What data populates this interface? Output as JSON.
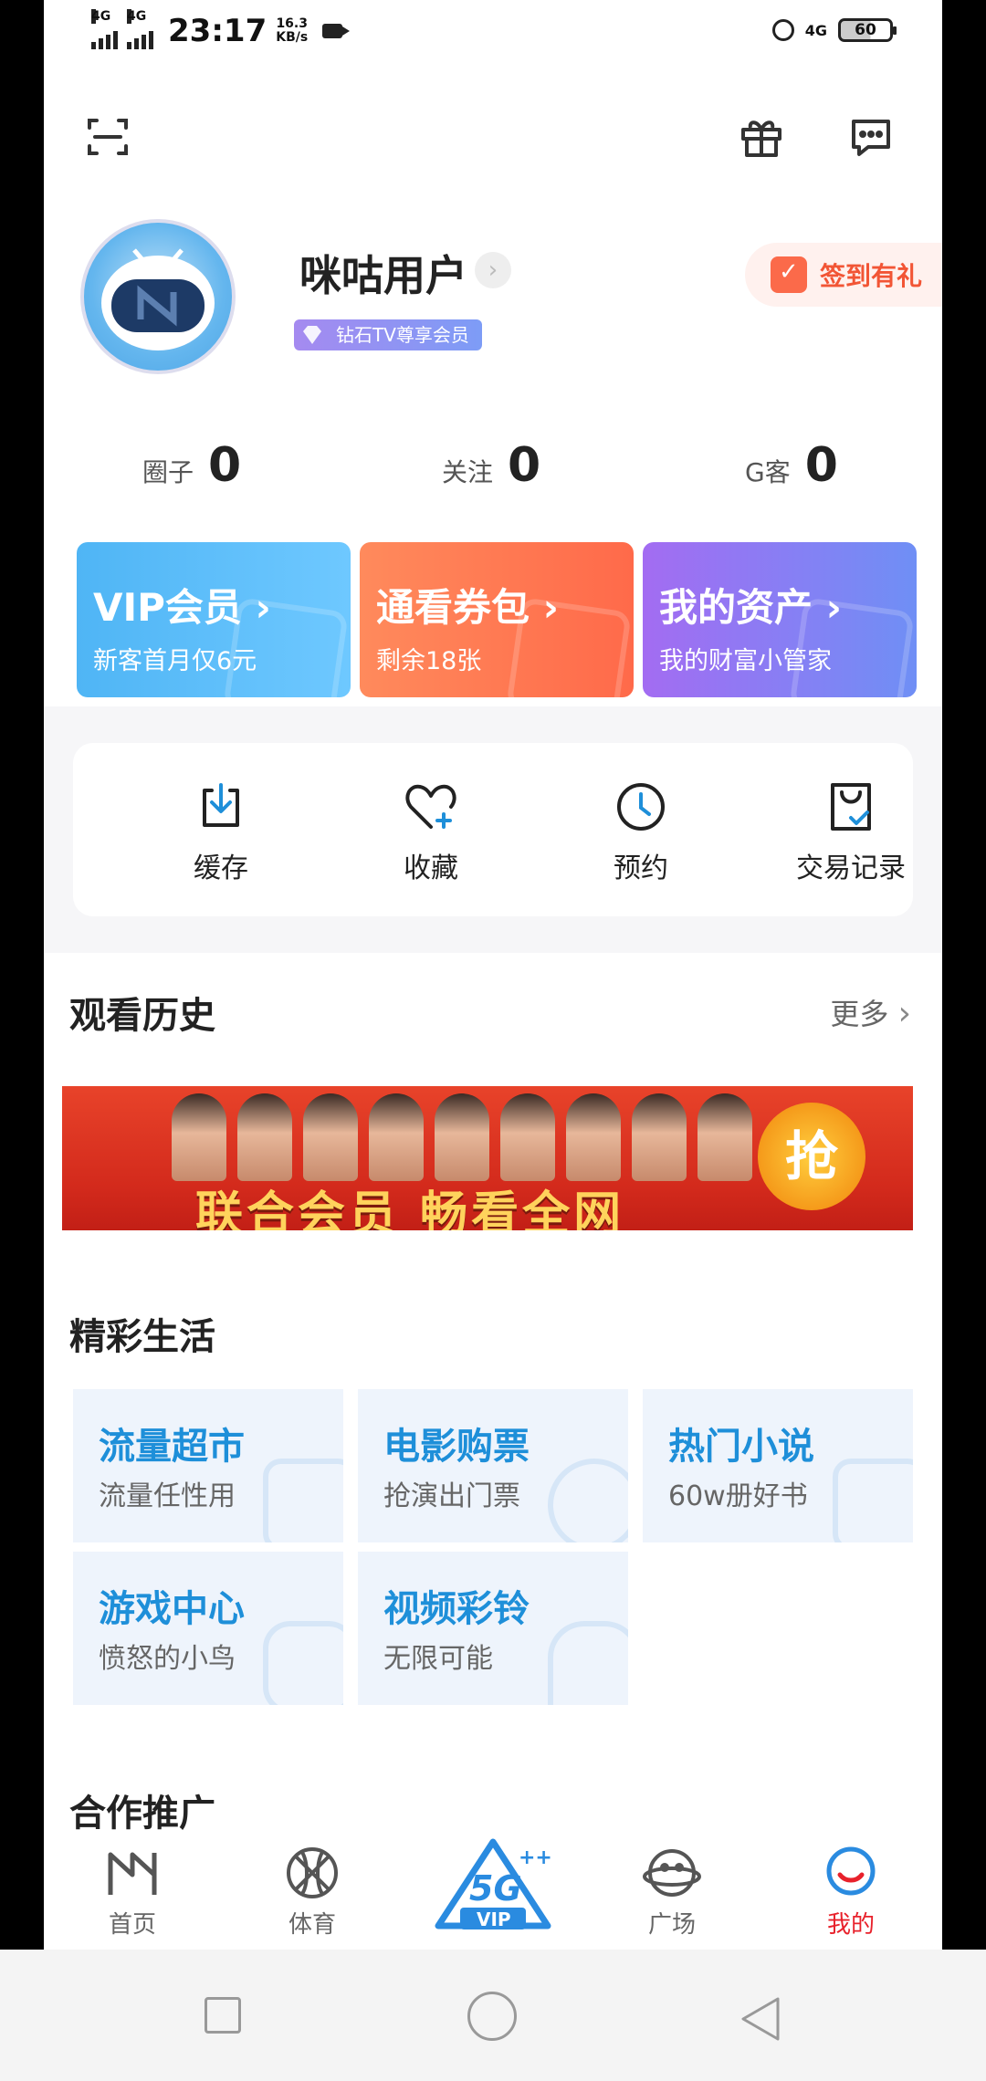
{
  "status_bar": {
    "signal1": "4G",
    "signal2": "4G",
    "time": "23:17",
    "speed_value": "16.3",
    "speed_unit": "KB/s",
    "network": "4G",
    "battery": "60"
  },
  "header": {
    "scan_icon": "scan-icon",
    "gift_icon": "gift-icon",
    "message_icon": "message-icon"
  },
  "profile": {
    "username": "咪咕用户",
    "vip_badge": "钻石TV尊享会员",
    "checkin_label": "签到有礼"
  },
  "stats": [
    {
      "label": "圈子",
      "value": "0"
    },
    {
      "label": "关注",
      "value": "0"
    },
    {
      "label": "G客",
      "value": "0"
    }
  ],
  "cards": [
    {
      "title": "VIP会员",
      "subtitle": "新客首月仅6元",
      "color_from": "#4fb5f5",
      "color_to": "#6ec8ff"
    },
    {
      "title": "通看券包",
      "subtitle": "剩余18张",
      "color_from": "#ff8a5c",
      "color_to": "#ff6a4a"
    },
    {
      "title": "我的资产",
      "subtitle": "我的财富小管家",
      "color_from": "#a36cf2",
      "color_to": "#6f8ff5"
    }
  ],
  "tools": [
    {
      "label": "缓存",
      "icon": "download-icon"
    },
    {
      "label": "收藏",
      "icon": "heart-plus-icon"
    },
    {
      "label": "预约",
      "icon": "clock-icon"
    },
    {
      "label": "交易记录",
      "icon": "bag-check-icon"
    }
  ],
  "history": {
    "title": "观看历史",
    "more": "更多"
  },
  "banner": {
    "text": "联合会员 畅看全网",
    "button": "抢"
  },
  "life": {
    "title": "精彩生活",
    "items": [
      {
        "title": "流量超市",
        "subtitle": "流量任性用"
      },
      {
        "title": "电影购票",
        "subtitle": "抢演出门票"
      },
      {
        "title": "热门小说",
        "subtitle": "60w册好书"
      },
      {
        "title": "游戏中心",
        "subtitle": "愤怒的小鸟"
      },
      {
        "title": "视频彩铃",
        "subtitle": "无限可能"
      }
    ]
  },
  "partner": {
    "title": "合作推广"
  },
  "tabs": [
    {
      "label": "首页",
      "icon": "migu-logo-icon"
    },
    {
      "label": "体育",
      "icon": "basketball-icon"
    },
    {
      "label": "VIP",
      "icon": "5g-vip-icon"
    },
    {
      "label": "广场",
      "icon": "planet-icon"
    },
    {
      "label": "我的",
      "icon": "smiley-icon",
      "active": true
    }
  ],
  "colors": {
    "accent": "#1e8fd9",
    "active_tab": "#e8212b",
    "checkin": "#f25535"
  }
}
